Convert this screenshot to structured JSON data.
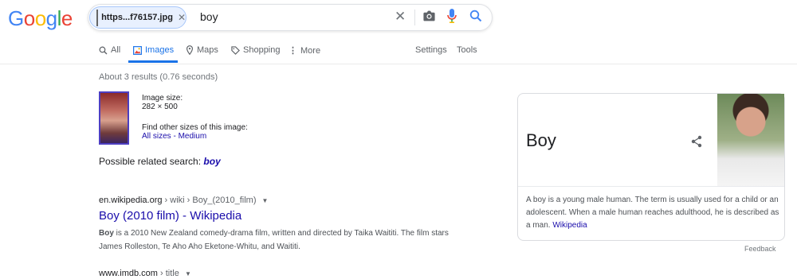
{
  "logo": {
    "c1": "G",
    "c2": "o",
    "c3": "o",
    "c4": "g",
    "c5": "l",
    "c6": "e"
  },
  "search": {
    "chip_label": "https...f76157.jpg",
    "query": "boy",
    "icons": [
      "close-icon",
      "camera-icon",
      "mic-icon",
      "search-icon"
    ]
  },
  "tabs": [
    {
      "label": "All",
      "icon": "search-icon"
    },
    {
      "label": "Images",
      "icon": "image-icon",
      "active": true
    },
    {
      "label": "Maps",
      "icon": "map-pin-icon"
    },
    {
      "label": "Shopping",
      "icon": "tag-icon"
    },
    {
      "label": "More",
      "icon": "more-vert-icon"
    }
  ],
  "settings_label": "Settings",
  "tools_label": "Tools",
  "stats": "About 3 results (0.76 seconds)",
  "image_info": {
    "size_label": "Image size:",
    "size_value": "282 × 500",
    "other_sizes_label": "Find other sizes of this image:",
    "all_sizes": "All sizes",
    "sep": " - ",
    "medium": "Medium"
  },
  "related": {
    "label": "Possible related search: ",
    "query": "boy"
  },
  "results": [
    {
      "site": "en.wikipedia.org",
      "path": " › wiki › Boy_(2010_film)",
      "title": "Boy (2010 film) - Wikipedia",
      "snippet_bold": "Boy",
      "snippet": " is a 2010 New Zealand comedy-drama film, written and directed by Taika Waititi. The film stars James Rolleston, Te Aho Aho Eketone-Whitu, and Waititi."
    },
    {
      "site": "www.imdb.com",
      "path": " › title"
    }
  ],
  "knowledge_panel": {
    "title": "Boy",
    "description": "A boy is a young male human. The term is usually used for a child or an adolescent. When a male human reaches adulthood, he is described as a man. ",
    "source": "Wikipedia",
    "feedback": "Feedback"
  },
  "colors": {
    "accent": "#1a73e8",
    "link": "#1a0dab"
  }
}
